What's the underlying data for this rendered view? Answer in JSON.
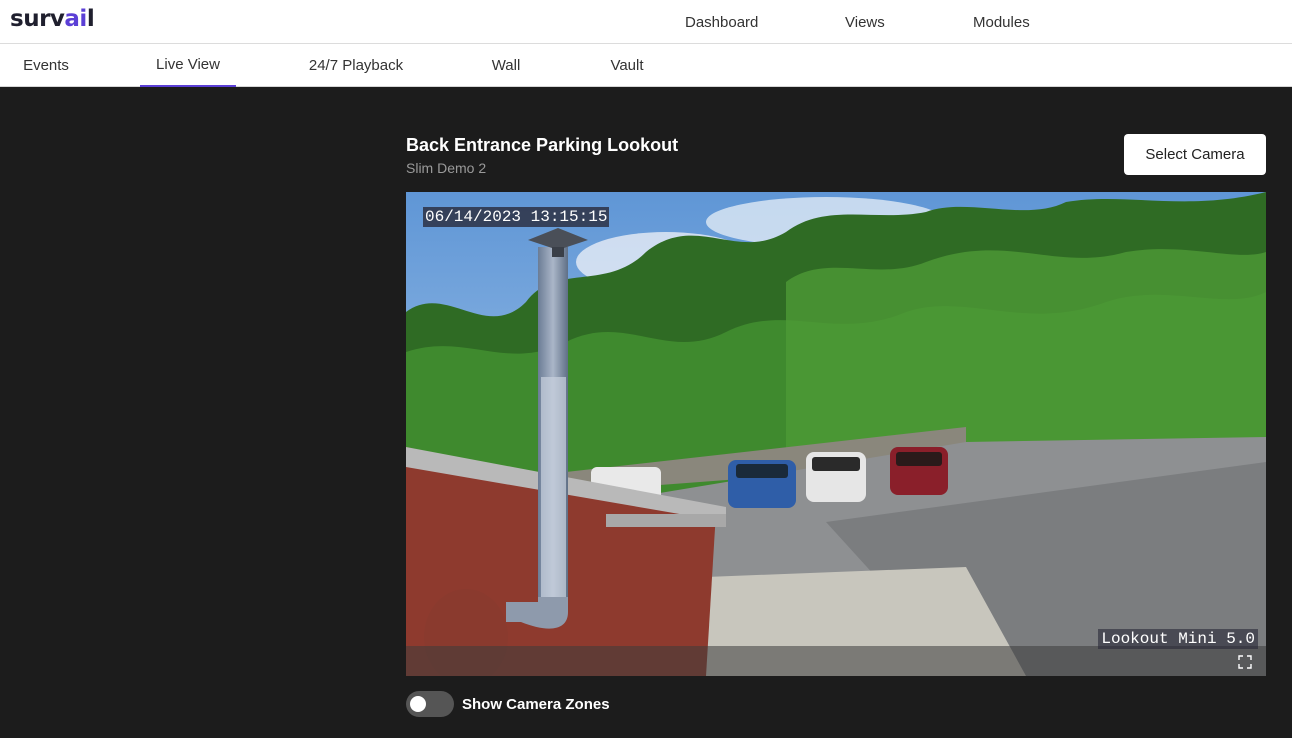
{
  "brand": {
    "logo_prefix": "surv",
    "logo_accent": "ai",
    "logo_suffix": "l",
    "accent_color": "#5b3fd6"
  },
  "top_nav": {
    "dashboard": "Dashboard",
    "views": "Views",
    "modules": "Modules"
  },
  "tabs": [
    {
      "label": "Events",
      "active": false
    },
    {
      "label": "Live View",
      "active": true
    },
    {
      "label": "24/7 Playback",
      "active": false
    },
    {
      "label": "Wall",
      "active": false
    },
    {
      "label": "Vault",
      "active": false
    }
  ],
  "camera": {
    "title": "Back Entrance Parking Lookout",
    "subtitle": "Slim Demo 2",
    "select_button": "Select Camera",
    "osd_timestamp": "06/14/2023 13:15:15",
    "osd_model": "Lookout Mini 5.0"
  },
  "zones_toggle": {
    "label": "Show Camera Zones",
    "enabled": false
  },
  "icons": {
    "fullscreen": "fullscreen-icon"
  }
}
